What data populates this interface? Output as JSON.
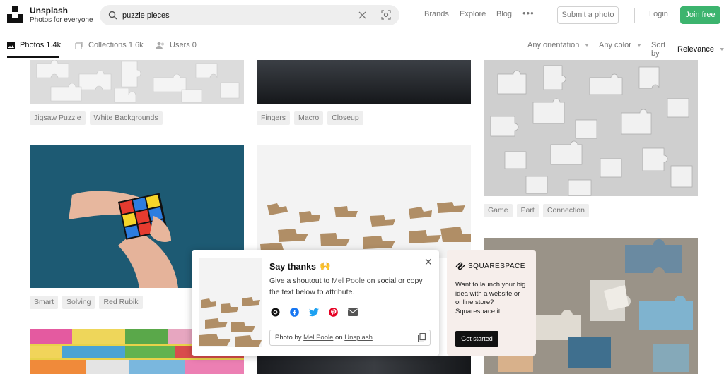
{
  "header": {
    "brand_name": "Unsplash",
    "brand_tagline": "Photos for everyone",
    "search_value": "puzzle pieces",
    "nav": [
      "Brands",
      "Explore",
      "Blog"
    ],
    "more": "•••",
    "submit_label": "Submit a photo",
    "login_label": "Login",
    "join_label": "Join free",
    "accent": "#3cb46e"
  },
  "tabs": {
    "photos": "Photos 1.4k",
    "collections": "Collections 1.6k",
    "users": "Users 0"
  },
  "filters": {
    "orientation": "Any orientation",
    "color": "Any color",
    "sort_prefix": "Sort by",
    "sort_value": "Relevance"
  },
  "grid": {
    "col1_tags_top": [
      "Jigsaw Puzzle",
      "White Backgrounds"
    ],
    "col2_tags_top": [
      "Fingers",
      "Macro",
      "Closeup"
    ],
    "col1_tags_mid": [
      "Smart",
      "Solving",
      "Red Rubik"
    ],
    "col3_tags_mid": [
      "Game",
      "Part",
      "Connection"
    ]
  },
  "popup": {
    "title": "Say thanks",
    "emoji": "🙌",
    "desc_prefix": "Give a shoutout to",
    "author": "Mel Poole",
    "desc_suffix": "on social or copy the text below to attribute.",
    "credit_prefix": "Photo by",
    "credit_author": "Mel Poole",
    "credit_mid": "on",
    "credit_site": "Unsplash",
    "close": "✕"
  },
  "ad": {
    "brand": "SQUARESPACE",
    "text": "Want to launch your big idea with a website or online store? Squarespace it.",
    "cta": "Get started"
  }
}
